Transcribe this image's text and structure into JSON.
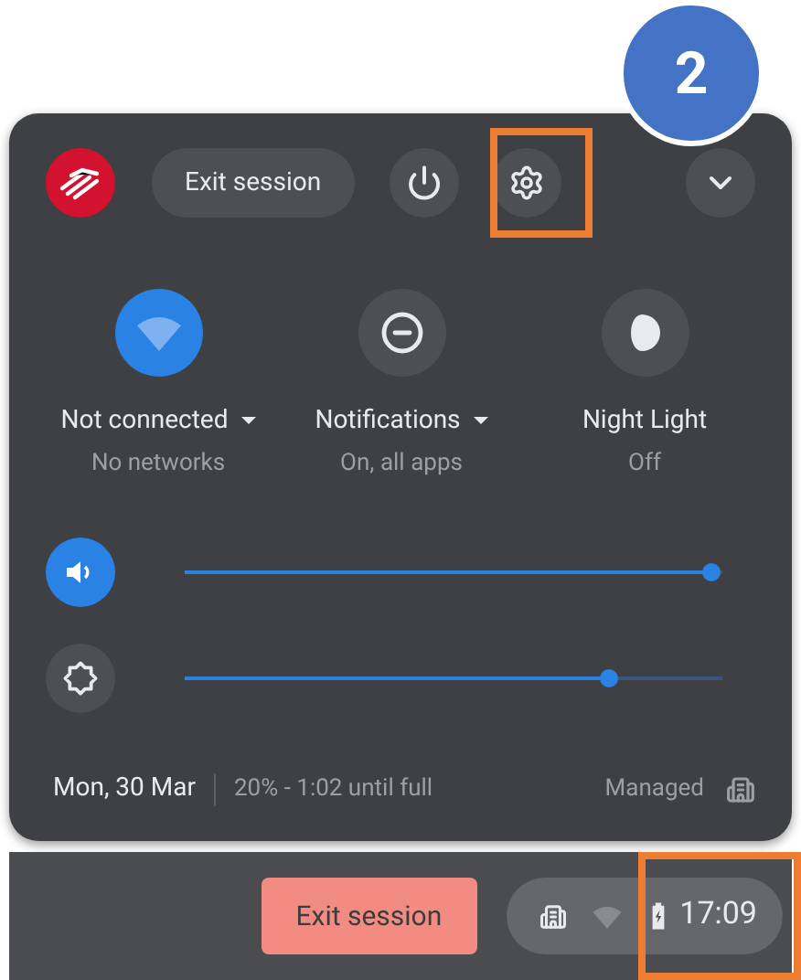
{
  "header": {
    "exit_session": "Exit session"
  },
  "feature_pods": [
    {
      "kind": "network",
      "label": "Not connected",
      "sublabel": "No networks",
      "on": true,
      "has_menu": true
    },
    {
      "kind": "notifications",
      "label": "Notifications",
      "sublabel": "On, all apps",
      "on": false,
      "has_menu": true
    },
    {
      "kind": "night_light",
      "label": "Night Light",
      "sublabel": "Off",
      "on": false,
      "has_menu": false
    }
  ],
  "sliders": [
    {
      "kind": "volume",
      "level": 0.98,
      "active": true
    },
    {
      "kind": "brightness",
      "level": 0.79,
      "active": false
    }
  ],
  "footer": {
    "date": "Mon, 30 Mar",
    "battery": "20% - 1:02 until full",
    "managed": "Managed"
  },
  "shelf": {
    "exit_session": "Exit session",
    "time": "17:09"
  },
  "annotation": {
    "step": "2"
  }
}
